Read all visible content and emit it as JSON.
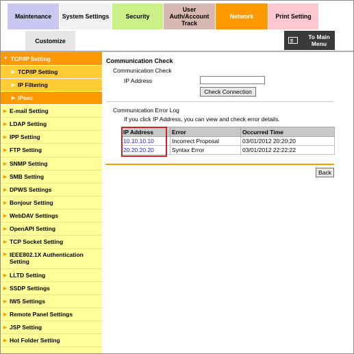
{
  "tabs": {
    "maintenance": "Maintenance",
    "system_settings": "System Settings",
    "security": "Security",
    "user_auth_line1": "User",
    "user_auth_line2": "Auth/Account",
    "user_auth_line3": "Track",
    "network": "Network",
    "print_setting": "Print Setting",
    "customize": "Customize"
  },
  "main_menu": {
    "line1": "To Main",
    "line2": "Menu",
    "icon": "menu-list-icon"
  },
  "sidebar": {
    "top": "TCP/IP Setting",
    "sub_items": [
      "TCP/IP Setting",
      "IP Filtering"
    ],
    "active_sub": "IPsec",
    "items": [
      "E-mail Setting",
      "LDAP Setting",
      "IPP Setting",
      "FTP Setting",
      "SNMP Setting",
      "SMB Setting",
      "DPWS Settings",
      "Bonjour Setting",
      "WebDAV Settings",
      "OpenAPI Setting",
      "TCP Socket Setting"
    ],
    "ieee_line1": "IEEE802.1X Authentication",
    "ieee_line2": "Setting",
    "items2": [
      "LLTD Setting",
      "SSDP Settings",
      "IWS Settings",
      "Remote Panel Settings",
      "JSP Setting",
      "Hot Folder Setting"
    ]
  },
  "content": {
    "title": "Communication Check",
    "sub_title": "Communication Check",
    "ip_label": "IP Address",
    "ip_value": "",
    "check_button": "Check Connection",
    "log_title": "Communication Error Log",
    "log_hint": "If you click IP Address, you can view and check error details.",
    "table": {
      "headers": [
        "IP Address",
        "Error",
        "Occurred Time"
      ],
      "rows": [
        [
          "10.10.10.10",
          "Incorrect Proposal",
          "03/01/2012 20:20:20"
        ],
        [
          "20.20.20.20",
          "Syntax Error",
          "03/01/2012 22:22:22"
        ]
      ]
    },
    "back_button": "Back"
  },
  "colors": {
    "accent": "#ff9900",
    "sidebar_bg": "#ffff99",
    "highlight_box": "#cc2222",
    "link": "#2222cc"
  }
}
